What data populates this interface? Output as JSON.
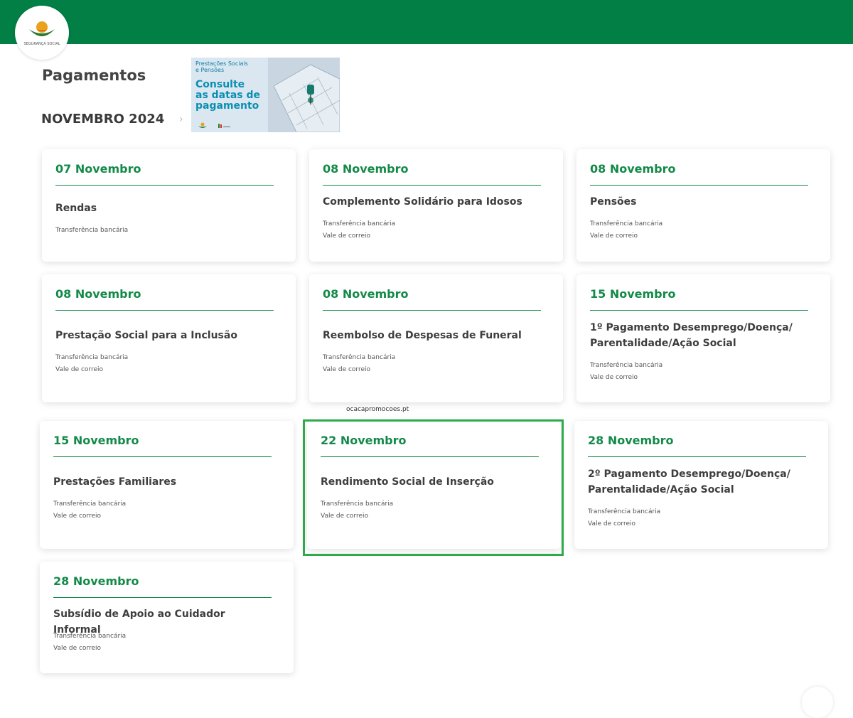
{
  "header": {
    "logo_text": "SEGURANÇA SOCIAL",
    "brand_color": "#017f45"
  },
  "page": {
    "title": "Pagamentos",
    "month": "NOVEMBRO 2024",
    "month_chevron": "›"
  },
  "banner": {
    "small_text_line1": "Prestações Sociais",
    "small_text_line2": "e Pensões",
    "big_text_line1": "Consulte",
    "big_text_line2": "as datas de",
    "big_text_line3": "pagamento"
  },
  "watermark": "ocacapromocoes.pt",
  "cards": [
    {
      "date": "07 Novembro",
      "title_line1": "Rendas",
      "title_line2": "",
      "methods": [
        "Transferência bancária"
      ]
    },
    {
      "date": "08 Novembro",
      "title_line1": "Complemento Solidário para Idosos",
      "title_line2": "",
      "methods": [
        "Transferência bancária",
        "Vale de correio"
      ]
    },
    {
      "date": "08 Novembro",
      "title_line1": "Pensões",
      "title_line2": "",
      "methods": [
        "Transferência bancária",
        "Vale de correio"
      ]
    },
    {
      "date": "08 Novembro",
      "title_line1": "Prestação Social para a Inclusão",
      "title_line2": "",
      "methods": [
        "Transferência bancária",
        "Vale de correio"
      ]
    },
    {
      "date": "08 Novembro",
      "title_line1": "Reembolso de Despesas de Funeral",
      "title_line2": "",
      "methods": [
        "Transferência bancária",
        "Vale de correio"
      ]
    },
    {
      "date": "15 Novembro",
      "title_line1": "1º Pagamento Desemprego/Doença/",
      "title_line2": "Parentalidade/Ação Social",
      "methods": [
        "Transferência bancária",
        "Vale de correio"
      ]
    },
    {
      "date": "15 Novembro",
      "title_line1": "Prestações Familiares",
      "title_line2": "",
      "methods": [
        "Transferência bancária",
        "Vale de correio"
      ]
    },
    {
      "date": "22 Novembro",
      "title_line1": "Rendimento Social de Inserção",
      "title_line2": "",
      "methods": [
        "Transferência bancária",
        "Vale de correio"
      ]
    },
    {
      "date": "28 Novembro",
      "title_line1": "2º Pagamento Desemprego/Doença/",
      "title_line2": "Parentalidade/Ação Social",
      "methods": [
        "Transferência bancária",
        "Vale de correio"
      ]
    },
    {
      "date": "28 Novembro",
      "title_line1": "Subsídio de Apoio ao Cuidador Informal",
      "title_line2": "",
      "methods": [
        "Transferência bancária",
        "Vale de correio"
      ]
    }
  ],
  "colors": {
    "accent_green": "#138a49",
    "highlight_border": "#2eaa4a"
  }
}
